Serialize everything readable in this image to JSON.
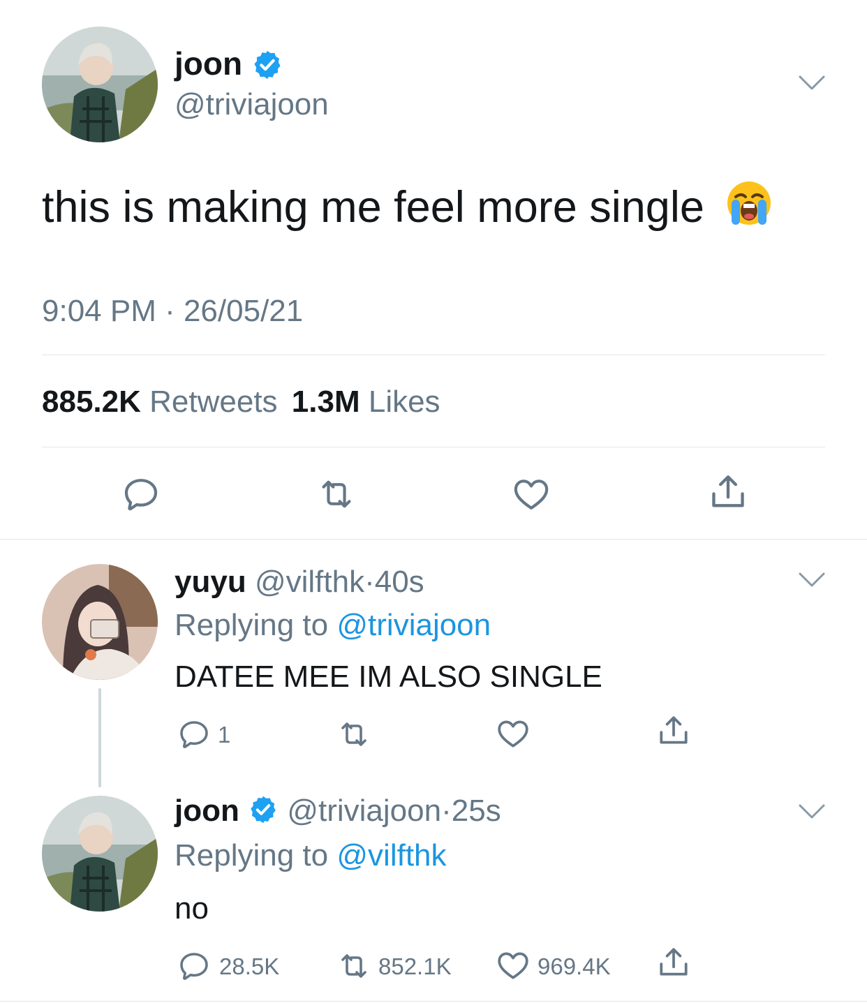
{
  "colors": {
    "text": "#14171a",
    "secondary": "#657786",
    "link": "#1b95e0",
    "divider": "#e1e8ed",
    "verified": "#1da1f2"
  },
  "main_tweet": {
    "display_name": "joon",
    "handle": "@triviajoon",
    "verified": true,
    "text": "this is making me feel more single",
    "emoji_icon": "loudly-crying-face-emoji",
    "timestamp": "9:04 PM · 26/05/21",
    "retweets_count": "885.2K",
    "retweets_label": "Retweets",
    "likes_count": "1.3M",
    "likes_label": "Likes",
    "actions": [
      "reply-icon",
      "retweet-icon",
      "like-icon",
      "share-icon"
    ]
  },
  "replies": [
    {
      "display_name": "yuyu",
      "handle": "@vilfthk",
      "separator": "·",
      "time": "40s",
      "replying_prefix": "Replying to",
      "replying_to": "@triviajoon",
      "text": "DATEE MEE IM ALSO SINGLE",
      "reply_count": "1",
      "retweet_count": "",
      "like_count": ""
    },
    {
      "display_name": "joon",
      "handle": "@triviajoon",
      "verified": true,
      "separator": "·",
      "time": "25s",
      "replying_prefix": "Replying to",
      "replying_to": "@vilfthk",
      "text": "no",
      "reply_count": "28.5K",
      "retweet_count": "852.1K",
      "like_count": "969.4K"
    }
  ]
}
